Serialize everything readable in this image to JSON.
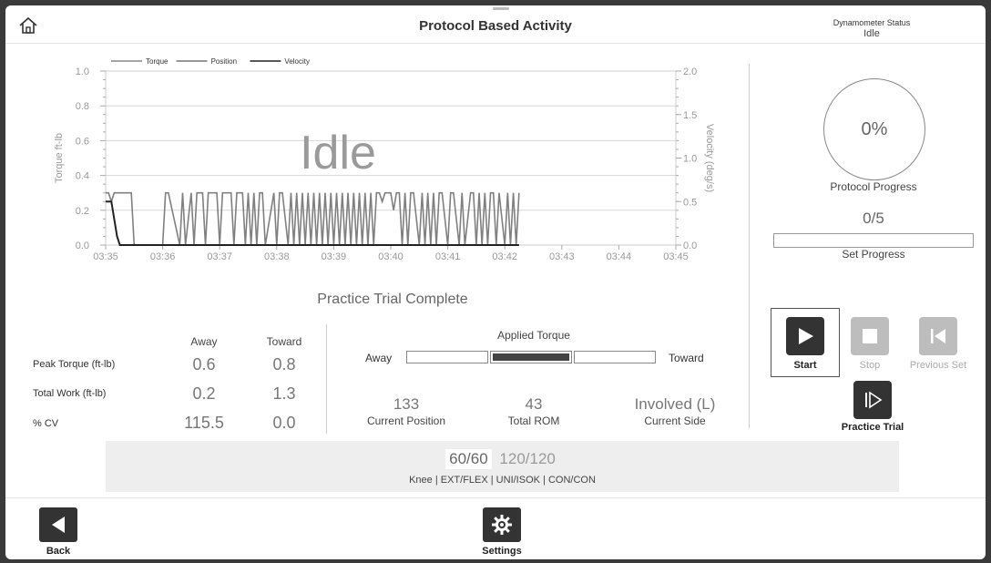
{
  "header": {
    "title": "Protocol Based Activity",
    "dyn_status_label": "Dynamometer Status",
    "dyn_status_value": "Idle"
  },
  "chart_data": {
    "type": "line",
    "overlay_text": "Idle",
    "legend": [
      "Torque",
      "Position",
      "Velocity"
    ],
    "legend_position": "top-left",
    "ylabel": "Torque ft-lb",
    "y2label": "Velocity (deg/s)",
    "ylim": [
      0,
      1.0
    ],
    "y2lim": [
      0,
      2.0
    ],
    "yticks": [
      "0.0",
      "0.2",
      "0.4",
      "0.6",
      "0.8",
      "1.0"
    ],
    "y2ticks": [
      "0.0",
      "0.5",
      "1.0",
      "1.5",
      "2.0"
    ],
    "xticks": [
      "03:35",
      "03:36",
      "03:37",
      "03:38",
      "03:39",
      "03:40",
      "03:41",
      "03:42",
      "03:43",
      "03:44",
      "03:45"
    ],
    "xlim_minutes": [
      0,
      10
    ],
    "grid": true,
    "series": [
      {
        "name": "Torque",
        "x": [
          0.0,
          0.05,
          0.1,
          0.15,
          0.2,
          0.3,
          0.45,
          0.5,
          1.0,
          1.05,
          1.1,
          1.3,
          1.35,
          1.4,
          1.5,
          1.55,
          1.6,
          1.7,
          1.75,
          1.8,
          1.95,
          2.0,
          2.05,
          2.2,
          2.25,
          2.3,
          2.4,
          2.45,
          2.5,
          2.55,
          2.6,
          2.65,
          2.7,
          2.75,
          2.8,
          2.95,
          3.0,
          3.05,
          3.1,
          3.2,
          3.25,
          3.3,
          3.35,
          3.4,
          3.45,
          3.5,
          3.55,
          3.6,
          3.65,
          3.7,
          3.75,
          3.8,
          3.85,
          3.9,
          3.95,
          4.0,
          4.05,
          4.1,
          4.15,
          4.2,
          4.25,
          4.3,
          4.35,
          4.4,
          4.45,
          4.5,
          4.55,
          4.6,
          4.65,
          4.7,
          4.75,
          4.8,
          4.85,
          4.9,
          4.95,
          5.0,
          5.05,
          5.1,
          5.15,
          5.2,
          5.25,
          5.3,
          5.35,
          5.4,
          5.5,
          5.55,
          5.6,
          5.65,
          5.7,
          5.75,
          5.8,
          5.85,
          5.9,
          6.0,
          6.05,
          6.1,
          6.2,
          6.25,
          6.3,
          6.4,
          6.45,
          6.5,
          6.55,
          6.6,
          6.65,
          6.7,
          6.75,
          6.8,
          6.85,
          6.9,
          7.0,
          7.05,
          7.1,
          7.15,
          7.2,
          7.25
        ],
        "y": [
          0.3,
          0.3,
          0.25,
          0.3,
          0.3,
          0.3,
          0.3,
          0.0,
          0.0,
          0.3,
          0.3,
          0.0,
          0.3,
          0.0,
          0.3,
          0.0,
          0.3,
          0.3,
          0.0,
          0.3,
          0.3,
          0.0,
          0.3,
          0.3,
          0.0,
          0.3,
          0.3,
          0.0,
          0.3,
          0.0,
          0.3,
          0.0,
          0.3,
          0.3,
          0.0,
          0.3,
          0.0,
          0.3,
          0.3,
          0.0,
          0.3,
          0.0,
          0.3,
          0.0,
          0.3,
          0.0,
          0.3,
          0.0,
          0.3,
          0.0,
          0.3,
          0.0,
          0.3,
          0.0,
          0.3,
          0.0,
          0.3,
          0.0,
          0.3,
          0.0,
          0.3,
          0.0,
          0.3,
          0.0,
          0.3,
          0.0,
          0.3,
          0.0,
          0.3,
          0.0,
          0.3,
          0.3,
          0.25,
          0.3,
          0.3,
          0.3,
          0.2,
          0.3,
          0.3,
          0.0,
          0.3,
          0.0,
          0.3,
          0.3,
          0.0,
          0.3,
          0.0,
          0.3,
          0.0,
          0.3,
          0.0,
          0.3,
          0.3,
          0.0,
          0.3,
          0.3,
          0.0,
          0.3,
          0.0,
          0.3,
          0.3,
          0.0,
          0.3,
          0.0,
          0.3,
          0.0,
          0.3,
          0.3,
          0.0,
          0.3,
          0.0,
          0.3,
          0.0,
          0.3,
          0.0,
          0.3
        ]
      },
      {
        "name": "Velocity",
        "x": [
          0.0,
          0.1,
          0.15,
          0.2,
          0.25,
          0.3,
          7.25
        ],
        "y": [
          0.25,
          0.25,
          0.15,
          0.05,
          0.0,
          0.0,
          0.0
        ]
      }
    ]
  },
  "progress": {
    "percent_text": "0%",
    "protocol_label": "Protocol Progress",
    "set_text": "0/5",
    "set_fraction": 0,
    "set_label": "Set Progress"
  },
  "trial_status": "Practice Trial Complete",
  "metrics": {
    "col_away": "Away",
    "col_toward": "Toward",
    "rows": [
      {
        "label": "Peak Torque (ft-lb)",
        "away": "0.6",
        "toward": "0.8"
      },
      {
        "label": "Total Work (ft-lb)",
        "away": "0.2",
        "toward": "1.3"
      },
      {
        "label": "% CV",
        "away": "115.5",
        "toward": "0.0"
      }
    ]
  },
  "applied_torque": {
    "title": "Applied Torque",
    "away_label": "Away",
    "toward_label": "Toward"
  },
  "stats": {
    "position_value": "133",
    "position_label": "Current Position",
    "rom_value": "43",
    "rom_label": "Total ROM",
    "side_value": "Involved (L)",
    "side_label": "Current Side"
  },
  "controls": {
    "start": "Start",
    "stop": "Stop",
    "previous_set": "Previous Set",
    "practice_trial": "Practice Trial"
  },
  "speeds": {
    "active": "60/60",
    "other": "120/120",
    "config": "Knee | EXT/FLEX | UNI/ISOK | CON/CON"
  },
  "footer": {
    "back": "Back",
    "settings": "Settings"
  },
  "colors": {
    "active_button": "#333333",
    "disabled_button": "#bdbdbd",
    "torque_line": "#888888",
    "velocity_line": "#222222"
  }
}
